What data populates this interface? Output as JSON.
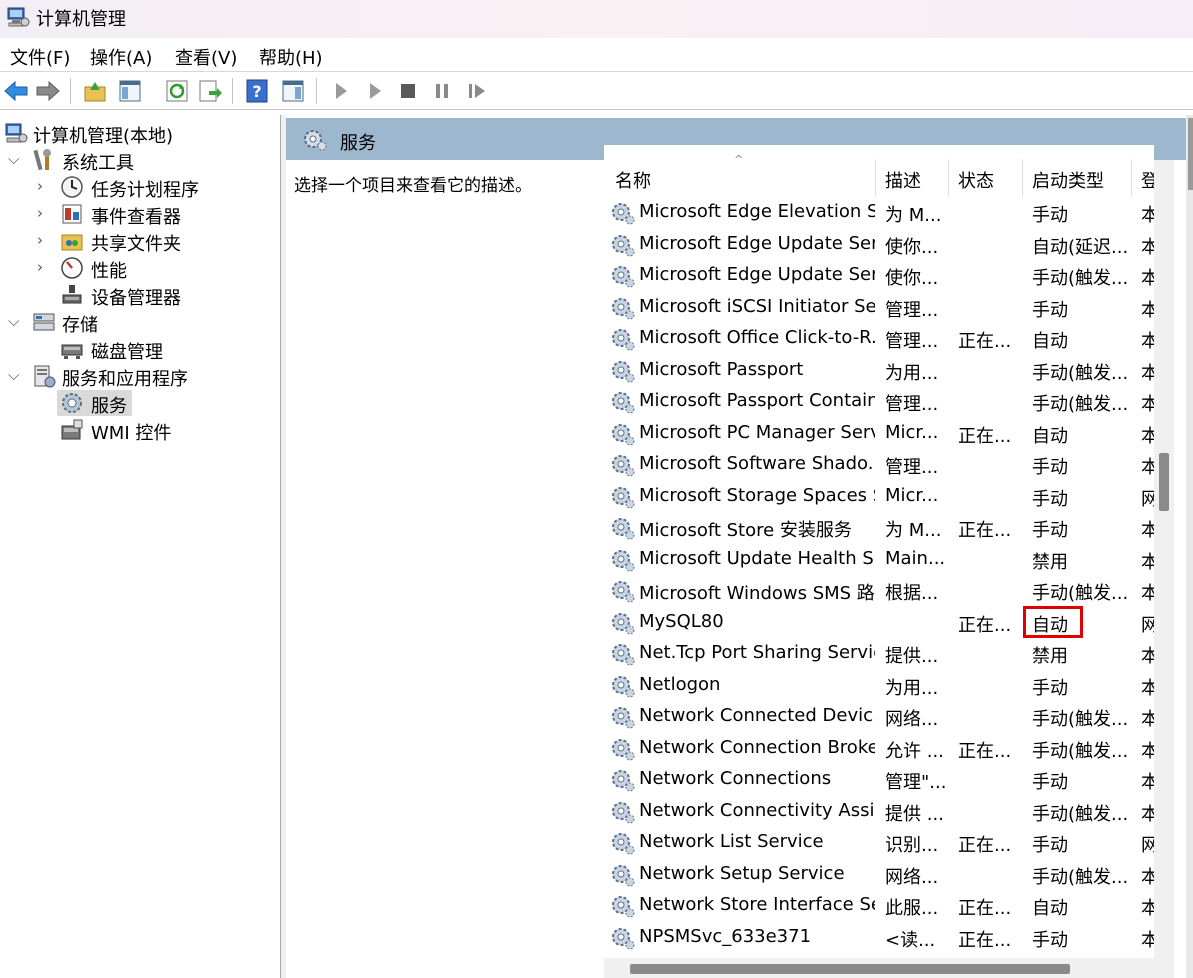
{
  "window": {
    "title": "计算机管理"
  },
  "menu": [
    "文件(F)",
    "操作(A)",
    "查看(V)",
    "帮助(H)"
  ],
  "toolbar": {
    "icons": [
      "back-arrow-icon",
      "forward-arrow-icon",
      "up-folder-icon",
      "show-hide-tree-icon",
      "refresh-icon",
      "export-list-icon",
      "help-icon",
      "show-hide-action-pane-icon",
      "start-service-icon",
      "start-service-alt-icon",
      "stop-service-icon",
      "pause-service-icon",
      "resume-service-icon"
    ]
  },
  "tree": [
    {
      "label": "计算机管理(本地)"
    },
    {
      "label": "系统工具"
    },
    {
      "label": "任务计划程序"
    },
    {
      "label": "事件查看器"
    },
    {
      "label": "共享文件夹"
    },
    {
      "label": "性能"
    },
    {
      "label": "设备管理器"
    },
    {
      "label": "存储"
    },
    {
      "label": "磁盘管理"
    },
    {
      "label": "服务和应用程序"
    },
    {
      "label": "服务"
    },
    {
      "label": "WMI 控件"
    }
  ],
  "pane": {
    "title": "服务",
    "description": "选择一个项目来查看它的描述。"
  },
  "columns": [
    "名称",
    "描述",
    "状态",
    "启动类型",
    "登"
  ],
  "services": [
    {
      "name": "Microsoft Edge Elevation S...",
      "desc": "为 M...",
      "status": "",
      "startup": "手动",
      "login": "本"
    },
    {
      "name": "Microsoft Edge Update Ser...",
      "desc": "使你...",
      "status": "",
      "startup": "自动(延迟...",
      "login": "本"
    },
    {
      "name": "Microsoft Edge Update Ser...",
      "desc": "使你...",
      "status": "",
      "startup": "手动(触发...",
      "login": "本"
    },
    {
      "name": "Microsoft iSCSI Initiator Ser...",
      "desc": "管理...",
      "status": "",
      "startup": "手动",
      "login": "本"
    },
    {
      "name": "Microsoft Office Click-to-R...",
      "desc": "管理...",
      "status": "正在...",
      "startup": "自动",
      "login": "本"
    },
    {
      "name": "Microsoft Passport",
      "desc": "为用...",
      "status": "",
      "startup": "手动(触发...",
      "login": "本"
    },
    {
      "name": "Microsoft Passport Container",
      "desc": "管理...",
      "status": "",
      "startup": "手动(触发...",
      "login": "本"
    },
    {
      "name": "Microsoft PC Manager Serv...",
      "desc": "Micr...",
      "status": "正在...",
      "startup": "自动",
      "login": "本"
    },
    {
      "name": "Microsoft Software Shado...",
      "desc": "管理...",
      "status": "",
      "startup": "手动",
      "login": "本"
    },
    {
      "name": "Microsoft Storage Spaces S...",
      "desc": "Micr...",
      "status": "",
      "startup": "手动",
      "login": "网"
    },
    {
      "name": "Microsoft Store 安装服务",
      "desc": "为 M...",
      "status": "正在...",
      "startup": "手动",
      "login": "本"
    },
    {
      "name": "Microsoft Update Health S...",
      "desc": "Main...",
      "status": "",
      "startup": "禁用",
      "login": "本"
    },
    {
      "name": "Microsoft Windows SMS 路...",
      "desc": "根据...",
      "status": "",
      "startup": "手动(触发...",
      "login": "本"
    },
    {
      "name": "MySQL80",
      "desc": "",
      "status": "正在...",
      "startup": "自动",
      "login": "网",
      "highlighted": true
    },
    {
      "name": "Net.Tcp Port Sharing Service",
      "desc": "提供...",
      "status": "",
      "startup": "禁用",
      "login": "本"
    },
    {
      "name": "Netlogon",
      "desc": "为用...",
      "status": "",
      "startup": "手动",
      "login": "本"
    },
    {
      "name": "Network Connected Devic...",
      "desc": "网络...",
      "status": "",
      "startup": "手动(触发...",
      "login": "本"
    },
    {
      "name": "Network Connection Broker",
      "desc": "允许 ...",
      "status": "正在...",
      "startup": "手动(触发...",
      "login": "本"
    },
    {
      "name": "Network Connections",
      "desc": "管理\"...",
      "status": "",
      "startup": "手动",
      "login": "本"
    },
    {
      "name": "Network Connectivity Assis...",
      "desc": "提供 ...",
      "status": "",
      "startup": "手动(触发...",
      "login": "本"
    },
    {
      "name": "Network List Service",
      "desc": "识别...",
      "status": "正在...",
      "startup": "手动",
      "login": "网"
    },
    {
      "name": "Network Setup Service",
      "desc": "网络...",
      "status": "",
      "startup": "手动(触发...",
      "login": "本"
    },
    {
      "name": "Network Store Interface Se...",
      "desc": "此服...",
      "status": "正在...",
      "startup": "自动",
      "login": "本"
    },
    {
      "name": "NPSMSvc_633e371",
      "desc": "<读...",
      "status": "正在...",
      "startup": "手动",
      "login": "本"
    }
  ],
  "colors": {
    "header_bg": "#9db7cf",
    "highlight": "#e00000",
    "selected_bg": "#d9d9d9"
  }
}
